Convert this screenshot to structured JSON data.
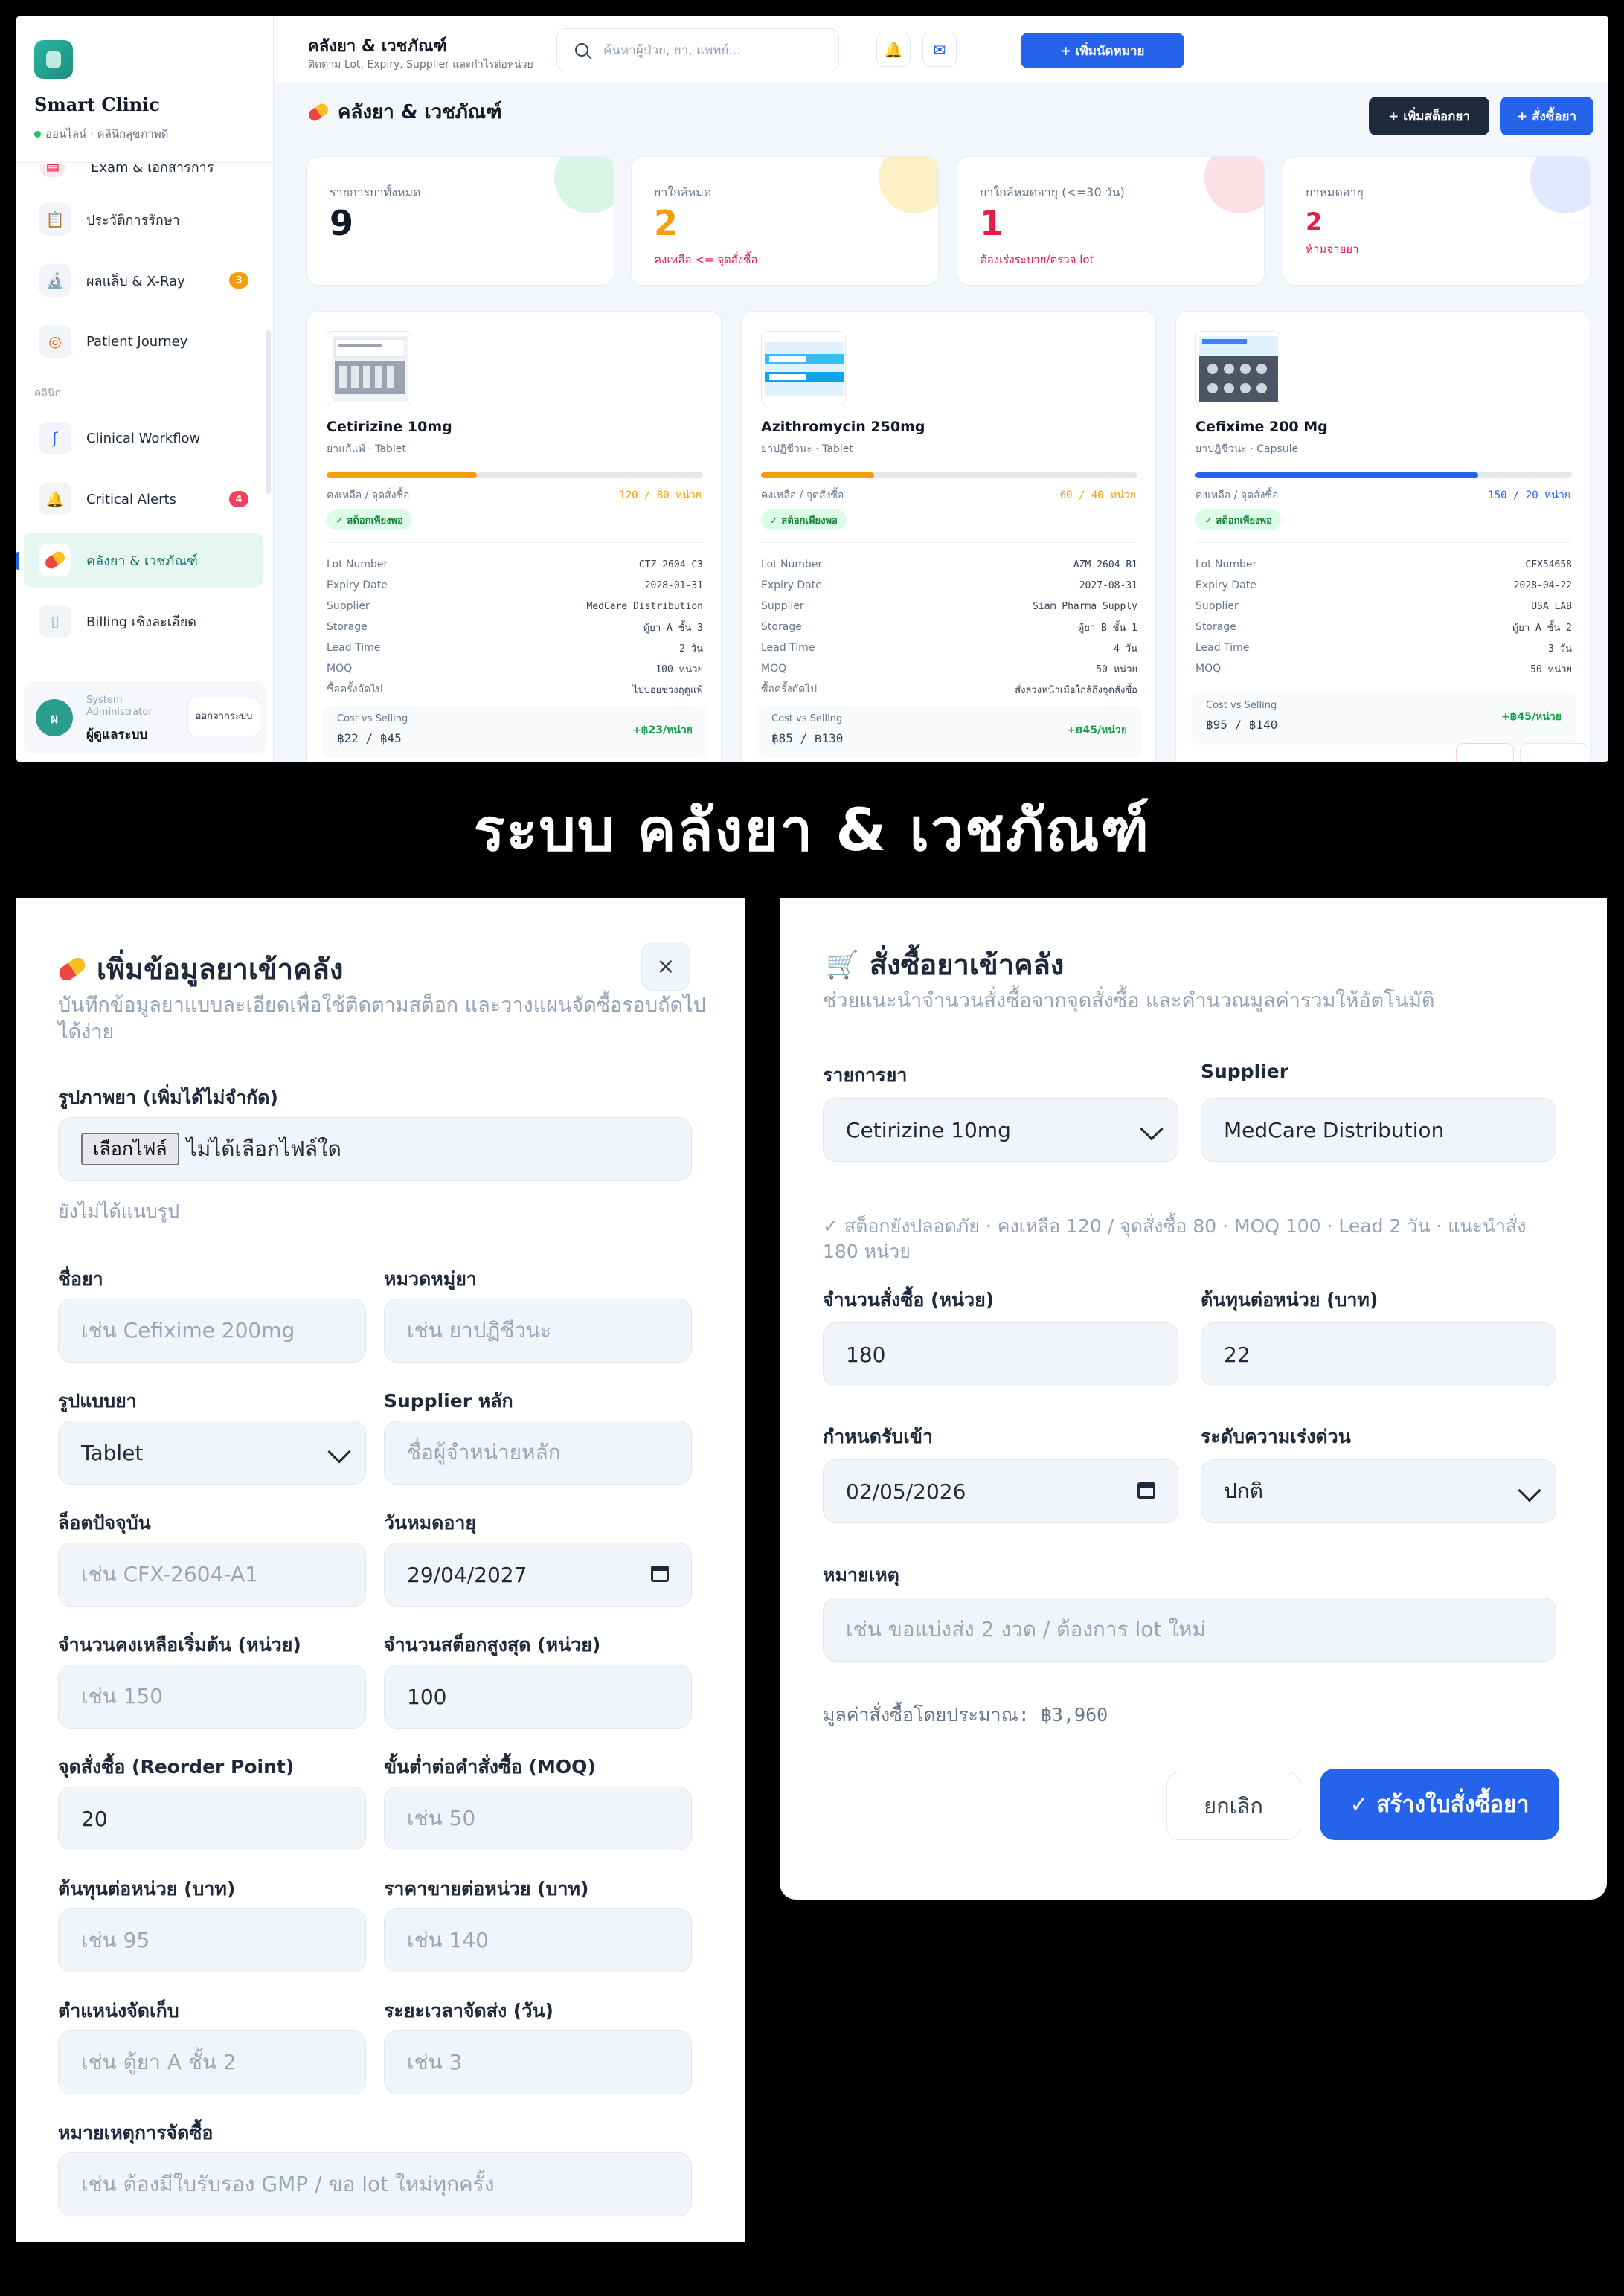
{
  "sidebar": {
    "brand_name": "Smart Clinic",
    "brand_status": "ออนไลน์ · คลินิกสุขภาพดี",
    "cut_item_label": "Exam & เอกสารการตรวจ",
    "items": [
      {
        "label": "ประวัติการรักษา",
        "icon": "clipboard-icon"
      },
      {
        "label": "ผลแล็บ & X-Ray",
        "icon": "microscope-icon",
        "badge": "3"
      },
      {
        "label": "Patient Journey",
        "icon": "target-icon"
      },
      {
        "label": "Clinical Workflow",
        "icon": "stethoscope-icon"
      },
      {
        "label": "Critical Alerts",
        "icon": "alert-bell-icon",
        "badge": "4"
      },
      {
        "label": "คลังยา & เวชภัณฑ์",
        "icon": "pill-icon"
      },
      {
        "label": "Billing เชิงละเอียด",
        "icon": "receipt-icon"
      }
    ],
    "section_clinic": "คลินิก",
    "user_role": "System Administrator",
    "user_name": "ผู้ดูแลระบบ",
    "avatar_letter": "ผ",
    "logout_label": "ออกจากระบบ"
  },
  "header": {
    "title": "คลังยา & เวชภัณฑ์",
    "subtitle": "ติดตาม Lot, Expiry, Supplier และกำไรต่อหน่วย",
    "search_placeholder": "ค้นหาผู้ป่วย, ยา, แพทย์...",
    "add_appointment_label": "+ เพิ่มนัดหมาย"
  },
  "main": {
    "page_title": "คลังยา & เวชภัณฑ์",
    "add_stock_label": "+ เพิ่มสต็อกยา",
    "order_label": "+ สั่งซื้อยา",
    "stats": [
      {
        "label": "รายการยาทั้งหมด",
        "value": "9",
        "sub": ""
      },
      {
        "label": "ยาใกล้หมด",
        "value": "2",
        "sub": "คงเหลือ <= จุดสั่งซื้อ"
      },
      {
        "label": "ยาใกล้หมดอายุ (<=30 วัน)",
        "value": "1",
        "sub": "ต้องเร่งระบาย/ตรวจ lot"
      },
      {
        "label": "ยาหมดอายุ",
        "value": "2",
        "sub": "ห้ามจ่ายยา"
      }
    ],
    "kv_labels": [
      "Lot Number",
      "Expiry Date",
      "Supplier",
      "Storage",
      "Lead Time",
      "MOQ",
      "ซื้อครั้งถัดไป"
    ],
    "stock_label": "คงเหลือ / จุดสั่งซื้อ",
    "ok_badge": "✓ สต็อกเพียงพอ",
    "cost_label": "Cost vs Selling",
    "drugs": [
      {
        "name": "Cetirizine 10mg",
        "category": "ยาแก้แพ้ · Tablet",
        "stock": "120 / 80 หน่วย",
        "stock_fill": 0.4,
        "lot": "CTZ-2604-C3",
        "expiry": "2028-01-31",
        "supplier": "MedCare Distribution",
        "storage": "ตู้ยา A ชั้น 3",
        "lead_time": "2 วัน",
        "moq": "100 หน่วย",
        "next_buy": "ไปบ่อยช่วงฤดูแพ้",
        "cost_selling": "฿22 / ฿45",
        "margin": "+฿23/หน่วย"
      },
      {
        "name": "Azithromycin 250mg",
        "category": "ยาปฏิชีวนะ · Tablet",
        "stock": "60 / 40 หน่วย",
        "stock_fill": 0.3,
        "lot": "AZM-2604-B1",
        "expiry": "2027-08-31",
        "supplier": "Siam Pharma Supply",
        "storage": "ตู้ยา B ชั้น 1",
        "lead_time": "4 วัน",
        "moq": "50 หน่วย",
        "next_buy": "สั่งล่วงหน้าเมื่อใกล้ถึงจุดสั่งซื้อ",
        "cost_selling": "฿85 / ฿130",
        "margin": "+฿45/หน่วย"
      },
      {
        "name": "Cefixime 200 Mg",
        "category": "ยาปฏิชีวนะ · Capsule",
        "stock": "150 / 20 หน่วย",
        "stock_fill": 0.75,
        "lot": "CFX54658",
        "expiry": "2028-04-22",
        "supplier": "USA LAB",
        "storage": "ตู้ยา A ชั้น 2",
        "lead_time": "3 วัน",
        "moq": "50 หน่วย",
        "next_buy": "",
        "cost_selling": "฿95 / ฿140",
        "margin": "+฿45/หน่วย"
      }
    ]
  },
  "banner": {
    "text": "ระบบ คลังยา & เวชภัณฑ์"
  },
  "add_modal": {
    "title": "เพิ่มข้อมูลยาเข้าคลัง",
    "subtitle": "บันทึกข้อมูลยาแบบละเอียดเพื่อใช้ติดตามสต็อก และวางแผนจัดซื้อรอบถัดไปได้ง่าย",
    "close": "×",
    "image_label": "รูปภาพยา (เพิ่มได้ไม่จำกัด)",
    "file_button": "เลือกไฟล์",
    "file_none": "ไม่ได้เลือกไฟล์ใด",
    "no_image": "ยังไม่ได้แนบรูป",
    "fields": {
      "name": {
        "label": "ชื่อยา",
        "placeholder": "เช่น Cefixime 200mg"
      },
      "category": {
        "label": "หมวดหมู่ยา",
        "placeholder": "เช่น ยาปฏิชีวนะ"
      },
      "form": {
        "label": "รูปแบบยา",
        "value": "Tablet"
      },
      "supplier": {
        "label": "Supplier หลัก",
        "placeholder": "ชื่อผู้จำหน่ายหลัก"
      },
      "lot": {
        "label": "ล็อตปัจจุบัน",
        "placeholder": "เช่น CFX-2604-A1"
      },
      "expiry": {
        "label": "วันหมดอายุ",
        "value": "29/04/2027"
      },
      "initial_qty": {
        "label": "จำนวนคงเหลือเริ่มต้น (หน่วย)",
        "placeholder": "เช่น 150"
      },
      "max_stock": {
        "label": "จำนวนสต็อกสูงสุด (หน่วย)",
        "value": "100"
      },
      "reorder": {
        "label": "จุดสั่งซื้อ (Reorder Point)",
        "value": "20"
      },
      "moq": {
        "label": "ขั้นต่ำต่อคำสั่งซื้อ (MOQ)",
        "placeholder": "เช่น 50"
      },
      "cost": {
        "label": "ต้นทุนต่อหน่วย (บาท)",
        "placeholder": "เช่น 95"
      },
      "price": {
        "label": "ราคาขายต่อหน่วย (บาท)",
        "placeholder": "เช่น 140"
      },
      "storage": {
        "label": "ตำแหน่งจัดเก็บ",
        "placeholder": "เช่น ตู้ยา A ชั้น 2"
      },
      "lead": {
        "label": "ระยะเวลาจัดส่ง (วัน)",
        "placeholder": "เช่น 3"
      },
      "note": {
        "label": "หมายเหตุการจัดซื้อ",
        "placeholder": "เช่น ต้องมีใบรับรอง GMP / ขอ lot ใหม่ทุกครั้ง"
      }
    }
  },
  "order_modal": {
    "title": "สั่งซื้อยาเข้าคลัง",
    "subtitle": "ช่วยแนะนำจำนวนสั่งซื้อจากจุดสั่งซื้อ และคำนวณมูลค่ารวมให้อัตโนมัติ",
    "drug_label": "รายการยา",
    "drug_value": "Cetirizine 10mg",
    "supplier_label": "Supplier",
    "supplier_value": "MedCare Distribution",
    "hint": "✓ สต็อกยังปลอดภัย · คงเหลือ 120 / จุดสั่งซื้อ 80 · MOQ 100 · Lead 2 วัน · แนะนำสั่ง 180 หน่วย",
    "qty_label": "จำนวนสั่งซื้อ (หน่วย)",
    "qty_value": "180",
    "unit_cost_label": "ต้นทุนต่อหน่วย (บาท)",
    "unit_cost_value": "22",
    "receive_label": "กำหนดรับเข้า",
    "receive_value": "02/05/2026",
    "urgency_label": "ระดับความเร่งด่วน",
    "urgency_value": "ปกติ",
    "note_label": "หมายเหตุ",
    "note_placeholder": "เช่น ขอแบ่งส่ง 2 งวด / ต้องการ lot ใหม่",
    "total": "มูลค่าสั่งซื้อโดยประมาณ: ฿3,960",
    "cancel": "ยกเลิก",
    "create": "✓ สร้างใบสั่งซื้อยา"
  }
}
